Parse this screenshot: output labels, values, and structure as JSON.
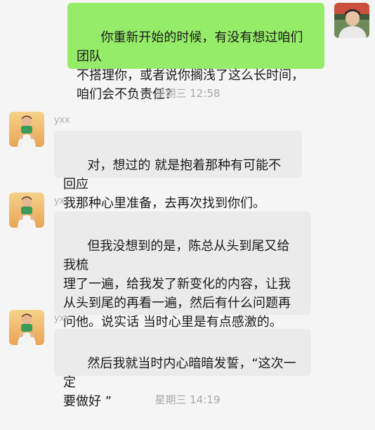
{
  "messages": [
    {
      "direction": "outgoing",
      "avatar_icon": "self-avatar-icon",
      "text": "你重新开始的时候，有没有想过咱们团队\n不搭理你，或者说你搁浅了这么长时间，\n咱们会不负责任？"
    },
    {
      "timestamp": "星期三 12:58"
    },
    {
      "direction": "incoming",
      "sender": "yxx",
      "avatar_icon": "contact-avatar-icon",
      "text": "对，想过的 就是抱着那种有可能不回应\n我那种心里准备，去再次找到你们。"
    },
    {
      "direction": "incoming",
      "sender": "yxx",
      "avatar_icon": "contact-avatar-icon",
      "text": "但我没想到的是，陈总从头到尾又给我梳\n理了一遍，给我发了新变化的内容，让我\n从头到尾的再看一遍，然后有什么问题再\n问他。说实话 当时心里是有点感激的。"
    },
    {
      "direction": "incoming",
      "sender": "yxx",
      "avatar_icon": "contact-avatar-icon",
      "text": "然后我就当时内心暗暗发誓，“这次一定\n要做好 ”"
    },
    {
      "timestamp": "星期三 14:19"
    }
  ],
  "colors": {
    "background": "#f5f5f5",
    "outgoing_bubble": "#95ec69",
    "incoming_bubble": "#ebebeb",
    "timestamp_text": "#a8a8a8",
    "sender_text": "#b2b2b2"
  }
}
